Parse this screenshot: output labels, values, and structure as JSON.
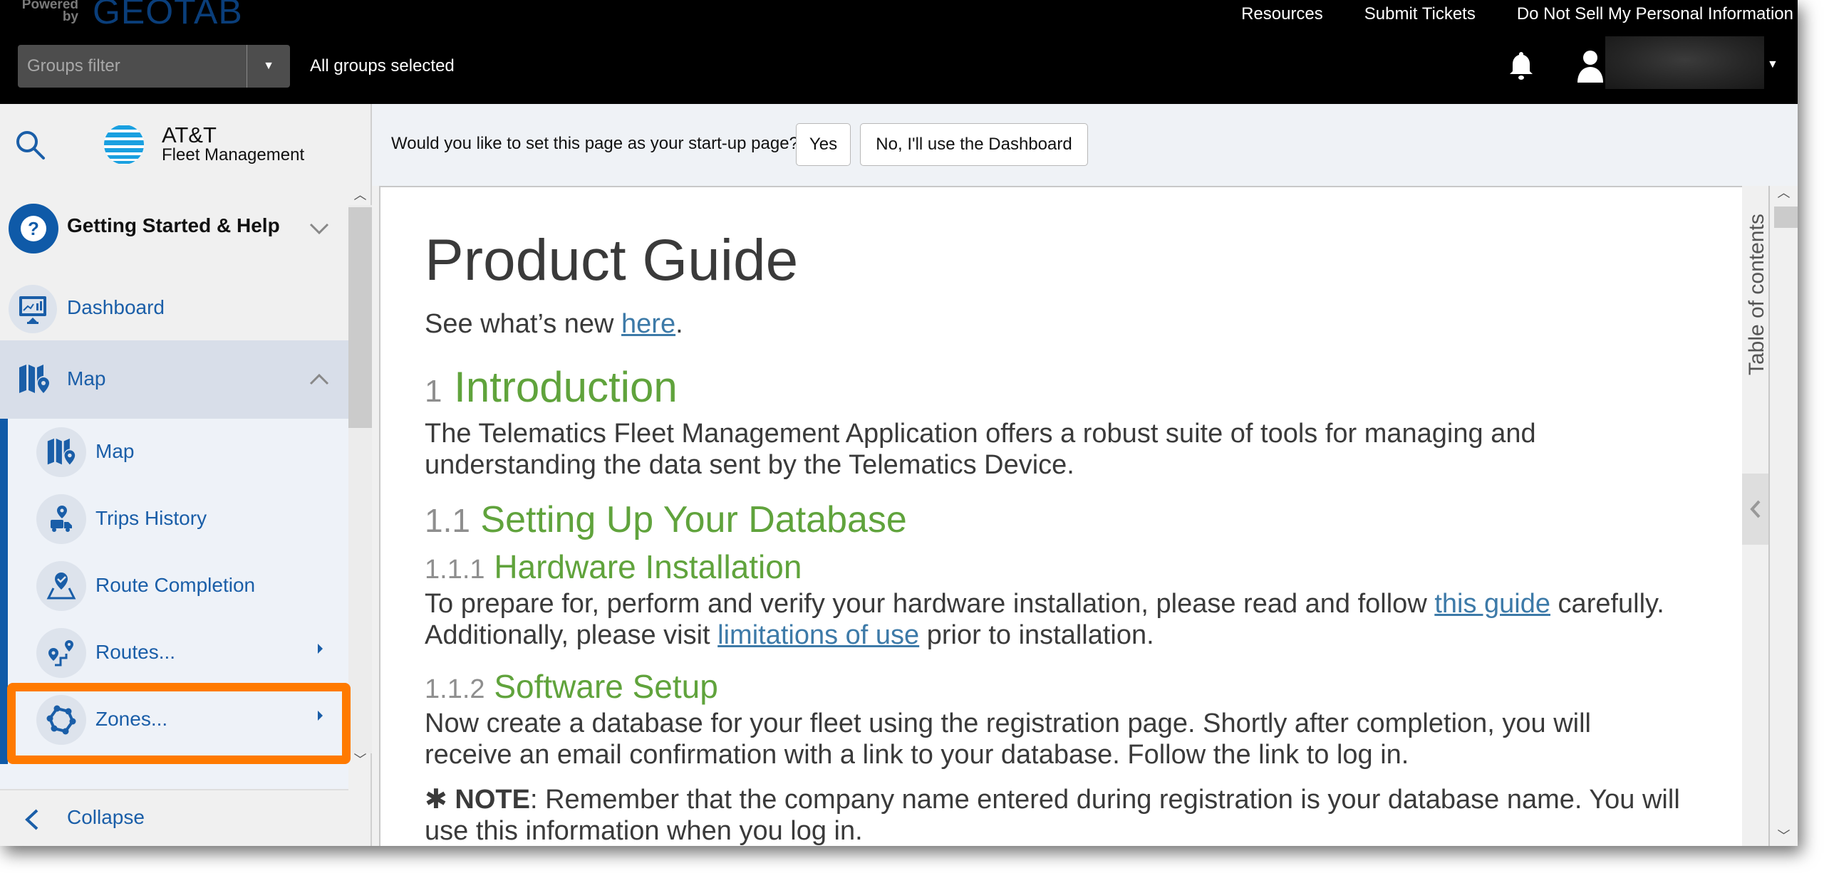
{
  "header": {
    "powered_by": "Powered by",
    "brand": "GEOTAB",
    "groups_filter": {
      "placeholder": "Groups filter",
      "value": ""
    },
    "groups_status": "All groups selected",
    "links": [
      "Resources",
      "Submit Tickets",
      "Do Not Sell My Personal Information"
    ],
    "icons": {
      "notifications": "bell-icon",
      "user": "user-icon",
      "user_menu": "caret-down-icon"
    }
  },
  "sidebar": {
    "brand_line1": "AT&T",
    "brand_line2": "Fleet Management",
    "items": [
      {
        "label": "Getting Started & Help",
        "icon": "help-icon",
        "expanded": false
      },
      {
        "label": "Dashboard",
        "icon": "dashboard-icon"
      },
      {
        "label": "Map",
        "icon": "map-icon",
        "expanded": true,
        "children": [
          {
            "label": "Map",
            "icon": "map-icon",
            "has_submenu": false
          },
          {
            "label": "Trips History",
            "icon": "trips-history-icon",
            "has_submenu": false
          },
          {
            "label": "Route Completion",
            "icon": "route-completion-icon",
            "has_submenu": false
          },
          {
            "label": "Routes...",
            "icon": "routes-icon",
            "has_submenu": true
          },
          {
            "label": "Zones...",
            "icon": "zones-icon",
            "has_submenu": true,
            "highlighted": true
          }
        ]
      }
    ],
    "collapse_label": "Collapse"
  },
  "banner": {
    "question": "Would you like to set this page as your start-up page?",
    "yes_label": "Yes",
    "no_label": "No, I'll use the Dashboard"
  },
  "document": {
    "title": "Product Guide",
    "whats_new_prefix": "See what’s new ",
    "whats_new_link": "here",
    "whats_new_suffix": ".",
    "sections": {
      "intro": {
        "num": "1",
        "title": "Introduction",
        "line1": "The Telematics Fleet Management Application offers a robust suite of tools for managing and",
        "line2": "understanding the data sent by the Telematics Device."
      },
      "db": {
        "num": "1.1",
        "title": "Setting Up Your Database"
      },
      "hw": {
        "num": "1.1.1",
        "title": "Hardware Installation",
        "line1_prefix": "To prepare for, perform and verify your hardware installation, please read and follow ",
        "line1_link": "this guide",
        "line1_suffix": " carefully.",
        "line2_prefix": "Additionally, please visit ",
        "line2_link": "limitations of use",
        "line2_suffix": " prior to installation."
      },
      "sw": {
        "num": "1.1.2",
        "title": "Software Setup",
        "line1": "Now create a database for your fleet using the registration page. Shortly after completion, you will",
        "line2": "receive an email confirmation with a link to your database. Follow the link to log in.",
        "note_symbol": "✱",
        "note_label": "NOTE",
        "note_line1": ": Remember that the company name entered during registration is your database name. You will",
        "note_line2": "use this information when you log in."
      }
    }
  },
  "toc": {
    "label": "Table of contents"
  },
  "colors": {
    "accent_blue": "#0f5aa8",
    "link_blue": "#3d7aa8",
    "heading_green": "#60a33c",
    "highlight_orange": "#ff7a00",
    "header_bg": "#000000"
  }
}
